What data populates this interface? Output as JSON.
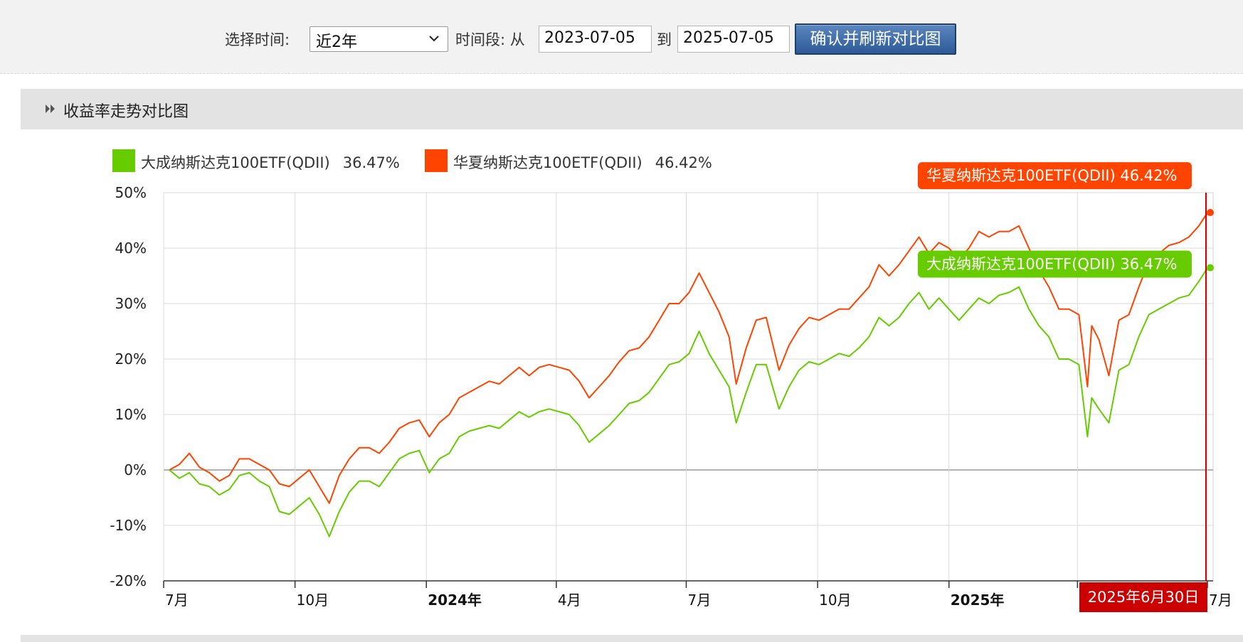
{
  "toolbar": {
    "time_label": "选择时间:",
    "range_value": "近2年",
    "period_label": "时间段: 从",
    "start_date": "2023-07-05",
    "to_label": "到",
    "end_date": "2025-07-05",
    "confirm_button": "确认并刷新对比图"
  },
  "section": {
    "title": "收益率走势对比图"
  },
  "legend": [
    {
      "name": "大成纳斯达克100ETF(QDII)",
      "value": "36.47%",
      "color": "#66cc00"
    },
    {
      "name": "华夏纳斯达克100ETF(QDII)",
      "value": "46.42%",
      "color": "#ff4400"
    }
  ],
  "tooltips": {
    "series2": "华夏纳斯达克100ETF(QDII) 46.42%",
    "series1": "大成纳斯达克100ETF(QDII) 36.47%",
    "date": "2025年6月30日"
  },
  "colors": {
    "series1": "#66cc00",
    "series2": "#ff4400",
    "crosshair": "#cc0000",
    "button": "#2d5a97"
  },
  "chart_data": {
    "type": "line",
    "title": "收益率走势对比图",
    "x_unit": "2023-07-05 to 2025-07-05 (date)",
    "y_unit": "%",
    "ylim": [
      -20,
      50
    ],
    "y_ticks": [
      50,
      40,
      30,
      20,
      10,
      0,
      -10,
      -20
    ],
    "y_tick_labels": [
      "50%",
      "40%",
      "30%",
      "20%",
      "10%",
      "0%",
      "-10%",
      "-20%"
    ],
    "x_ticks": [
      {
        "date": "2023-07-01",
        "label": "7月",
        "bold": false
      },
      {
        "date": "2023-10-01",
        "label": "10月",
        "bold": false
      },
      {
        "date": "2024-01-01",
        "label": "2024年",
        "bold": true
      },
      {
        "date": "2024-04-01",
        "label": "4月",
        "bold": false
      },
      {
        "date": "2024-07-01",
        "label": "7月",
        "bold": false
      },
      {
        "date": "2024-10-01",
        "label": "10月",
        "bold": false
      },
      {
        "date": "2025-01-01",
        "label": "2025年",
        "bold": true
      },
      {
        "date": "2025-04-01",
        "label": "4月",
        "bold": false
      },
      {
        "date": "2025-07-01",
        "label": "7月",
        "bold": false
      }
    ],
    "grid": true,
    "legend_position": "top-left",
    "highlight_date": "2025-06-30",
    "series": [
      {
        "name": "大成纳斯达克100ETF(QDII)",
        "color": "#66cc00",
        "final_value": 36.47,
        "points": [
          [
            "2023-07-05",
            0
          ],
          [
            "2023-07-12",
            -1.5
          ],
          [
            "2023-07-19",
            -0.5
          ],
          [
            "2023-07-26",
            -2.5
          ],
          [
            "2023-08-02",
            -3
          ],
          [
            "2023-08-09",
            -4.5
          ],
          [
            "2023-08-16",
            -3.5
          ],
          [
            "2023-08-23",
            -1
          ],
          [
            "2023-08-30",
            -0.5
          ],
          [
            "2023-09-06",
            -2
          ],
          [
            "2023-09-13",
            -3
          ],
          [
            "2023-09-20",
            -7.5
          ],
          [
            "2023-09-27",
            -8
          ],
          [
            "2023-10-04",
            -6.5
          ],
          [
            "2023-10-11",
            -5
          ],
          [
            "2023-10-18",
            -8
          ],
          [
            "2023-10-25",
            -12
          ],
          [
            "2023-11-01",
            -7.5
          ],
          [
            "2023-11-08",
            -4
          ],
          [
            "2023-11-15",
            -2
          ],
          [
            "2023-11-22",
            -2
          ],
          [
            "2023-11-29",
            -3
          ],
          [
            "2023-12-06",
            -0.5
          ],
          [
            "2023-12-13",
            2
          ],
          [
            "2023-12-20",
            3
          ],
          [
            "2023-12-27",
            3.5
          ],
          [
            "2024-01-03",
            -0.5
          ],
          [
            "2024-01-10",
            2
          ],
          [
            "2024-01-17",
            3
          ],
          [
            "2024-01-24",
            6
          ],
          [
            "2024-01-31",
            7
          ],
          [
            "2024-02-07",
            7.5
          ],
          [
            "2024-02-14",
            8
          ],
          [
            "2024-02-21",
            7.5
          ],
          [
            "2024-02-28",
            9
          ],
          [
            "2024-03-06",
            10.5
          ],
          [
            "2024-03-13",
            9.5
          ],
          [
            "2024-03-20",
            10.5
          ],
          [
            "2024-03-27",
            11
          ],
          [
            "2024-04-03",
            10.5
          ],
          [
            "2024-04-10",
            10
          ],
          [
            "2024-04-17",
            8
          ],
          [
            "2024-04-24",
            5
          ],
          [
            "2024-05-01",
            6.5
          ],
          [
            "2024-05-08",
            8
          ],
          [
            "2024-05-15",
            10
          ],
          [
            "2024-05-22",
            12
          ],
          [
            "2024-05-29",
            12.5
          ],
          [
            "2024-06-05",
            14
          ],
          [
            "2024-06-12",
            16.5
          ],
          [
            "2024-06-19",
            19
          ],
          [
            "2024-06-26",
            19.5
          ],
          [
            "2024-07-03",
            21
          ],
          [
            "2024-07-10",
            25
          ],
          [
            "2024-07-17",
            21
          ],
          [
            "2024-07-24",
            18
          ],
          [
            "2024-07-31",
            15
          ],
          [
            "2024-08-05",
            8.5
          ],
          [
            "2024-08-12",
            14
          ],
          [
            "2024-08-19",
            19
          ],
          [
            "2024-08-26",
            19
          ],
          [
            "2024-09-04",
            11
          ],
          [
            "2024-09-11",
            15
          ],
          [
            "2024-09-18",
            18
          ],
          [
            "2024-09-25",
            19.5
          ],
          [
            "2024-10-02",
            19
          ],
          [
            "2024-10-09",
            20
          ],
          [
            "2024-10-16",
            21
          ],
          [
            "2024-10-23",
            20.5
          ],
          [
            "2024-10-30",
            22
          ],
          [
            "2024-11-06",
            24
          ],
          [
            "2024-11-13",
            27.5
          ],
          [
            "2024-11-20",
            26
          ],
          [
            "2024-11-27",
            27.5
          ],
          [
            "2024-12-04",
            30
          ],
          [
            "2024-12-11",
            32
          ],
          [
            "2024-12-18",
            29
          ],
          [
            "2024-12-25",
            31
          ],
          [
            "2025-01-01",
            29
          ],
          [
            "2025-01-08",
            27
          ],
          [
            "2025-01-15",
            29
          ],
          [
            "2025-01-22",
            31
          ],
          [
            "2025-01-29",
            30
          ],
          [
            "2025-02-05",
            31.5
          ],
          [
            "2025-02-12",
            32
          ],
          [
            "2025-02-19",
            33
          ],
          [
            "2025-02-26",
            29
          ],
          [
            "2025-03-05",
            26
          ],
          [
            "2025-03-12",
            24
          ],
          [
            "2025-03-19",
            20
          ],
          [
            "2025-03-26",
            20
          ],
          [
            "2025-04-02",
            19
          ],
          [
            "2025-04-08",
            6
          ],
          [
            "2025-04-11",
            13
          ],
          [
            "2025-04-16",
            11
          ],
          [
            "2025-04-23",
            8.5
          ],
          [
            "2025-04-30",
            18
          ],
          [
            "2025-05-07",
            19
          ],
          [
            "2025-05-14",
            24
          ],
          [
            "2025-05-21",
            28
          ],
          [
            "2025-05-28",
            29
          ],
          [
            "2025-06-04",
            30
          ],
          [
            "2025-06-11",
            31
          ],
          [
            "2025-06-18",
            31.5
          ],
          [
            "2025-06-25",
            34
          ],
          [
            "2025-06-30",
            36
          ],
          [
            "2025-07-03",
            36.47
          ]
        ]
      },
      {
        "name": "华夏纳斯达克100ETF(QDII)",
        "color": "#ff4400",
        "final_value": 46.42,
        "points": [
          [
            "2023-07-05",
            0
          ],
          [
            "2023-07-12",
            1
          ],
          [
            "2023-07-19",
            3
          ],
          [
            "2023-07-26",
            0.5
          ],
          [
            "2023-08-02",
            -0.5
          ],
          [
            "2023-08-09",
            -2
          ],
          [
            "2023-08-16",
            -1
          ],
          [
            "2023-08-23",
            2
          ],
          [
            "2023-08-30",
            2
          ],
          [
            "2023-09-06",
            1
          ],
          [
            "2023-09-13",
            0
          ],
          [
            "2023-09-20",
            -2.5
          ],
          [
            "2023-09-27",
            -3
          ],
          [
            "2023-10-04",
            -1.5
          ],
          [
            "2023-10-11",
            0
          ],
          [
            "2023-10-18",
            -3
          ],
          [
            "2023-10-25",
            -6
          ],
          [
            "2023-11-01",
            -1
          ],
          [
            "2023-11-08",
            2
          ],
          [
            "2023-11-15",
            4
          ],
          [
            "2023-11-22",
            4
          ],
          [
            "2023-11-29",
            3
          ],
          [
            "2023-12-06",
            5
          ],
          [
            "2023-12-13",
            7.5
          ],
          [
            "2023-12-20",
            8.5
          ],
          [
            "2023-12-27",
            9
          ],
          [
            "2024-01-03",
            6
          ],
          [
            "2024-01-10",
            8.5
          ],
          [
            "2024-01-17",
            10
          ],
          [
            "2024-01-24",
            13
          ],
          [
            "2024-01-31",
            14
          ],
          [
            "2024-02-07",
            15
          ],
          [
            "2024-02-14",
            16
          ],
          [
            "2024-02-21",
            15.5
          ],
          [
            "2024-02-28",
            17
          ],
          [
            "2024-03-06",
            18.5
          ],
          [
            "2024-03-13",
            17
          ],
          [
            "2024-03-20",
            18.5
          ],
          [
            "2024-03-27",
            19
          ],
          [
            "2024-04-03",
            18.5
          ],
          [
            "2024-04-10",
            18
          ],
          [
            "2024-04-17",
            16
          ],
          [
            "2024-04-24",
            13
          ],
          [
            "2024-05-01",
            15
          ],
          [
            "2024-05-08",
            17
          ],
          [
            "2024-05-15",
            19.5
          ],
          [
            "2024-05-22",
            21.5
          ],
          [
            "2024-05-29",
            22
          ],
          [
            "2024-06-05",
            24
          ],
          [
            "2024-06-12",
            27
          ],
          [
            "2024-06-19",
            30
          ],
          [
            "2024-06-26",
            30
          ],
          [
            "2024-07-03",
            32
          ],
          [
            "2024-07-10",
            35.5
          ],
          [
            "2024-07-17",
            32
          ],
          [
            "2024-07-24",
            28.5
          ],
          [
            "2024-07-31",
            24
          ],
          [
            "2024-08-05",
            15.5
          ],
          [
            "2024-08-12",
            22
          ],
          [
            "2024-08-19",
            27
          ],
          [
            "2024-08-26",
            27.5
          ],
          [
            "2024-09-04",
            18
          ],
          [
            "2024-09-11",
            22.5
          ],
          [
            "2024-09-18",
            25.5
          ],
          [
            "2024-09-25",
            27.5
          ],
          [
            "2024-10-02",
            27
          ],
          [
            "2024-10-09",
            28
          ],
          [
            "2024-10-16",
            29
          ],
          [
            "2024-10-23",
            29
          ],
          [
            "2024-10-30",
            31
          ],
          [
            "2024-11-06",
            33
          ],
          [
            "2024-11-13",
            37
          ],
          [
            "2024-11-20",
            35
          ],
          [
            "2024-11-27",
            37
          ],
          [
            "2024-12-04",
            39.5
          ],
          [
            "2024-12-11",
            42
          ],
          [
            "2024-12-18",
            39
          ],
          [
            "2024-12-25",
            41
          ],
          [
            "2025-01-01",
            40
          ],
          [
            "2025-01-08",
            38
          ],
          [
            "2025-01-15",
            40
          ],
          [
            "2025-01-22",
            43
          ],
          [
            "2025-01-29",
            42
          ],
          [
            "2025-02-05",
            43
          ],
          [
            "2025-02-12",
            43
          ],
          [
            "2025-02-19",
            44
          ],
          [
            "2025-02-26",
            40
          ],
          [
            "2025-03-05",
            36
          ],
          [
            "2025-03-12",
            33
          ],
          [
            "2025-03-19",
            29
          ],
          [
            "2025-03-26",
            29
          ],
          [
            "2025-04-02",
            28
          ],
          [
            "2025-04-08",
            15
          ],
          [
            "2025-04-11",
            26
          ],
          [
            "2025-04-16",
            23.5
          ],
          [
            "2025-04-23",
            17
          ],
          [
            "2025-04-30",
            27
          ],
          [
            "2025-05-07",
            28
          ],
          [
            "2025-05-14",
            33
          ],
          [
            "2025-05-21",
            37.5
          ],
          [
            "2025-05-28",
            39
          ],
          [
            "2025-06-04",
            40.5
          ],
          [
            "2025-06-11",
            41
          ],
          [
            "2025-06-18",
            42
          ],
          [
            "2025-06-25",
            44
          ],
          [
            "2025-06-30",
            46
          ],
          [
            "2025-07-03",
            46.42
          ]
        ]
      }
    ]
  }
}
